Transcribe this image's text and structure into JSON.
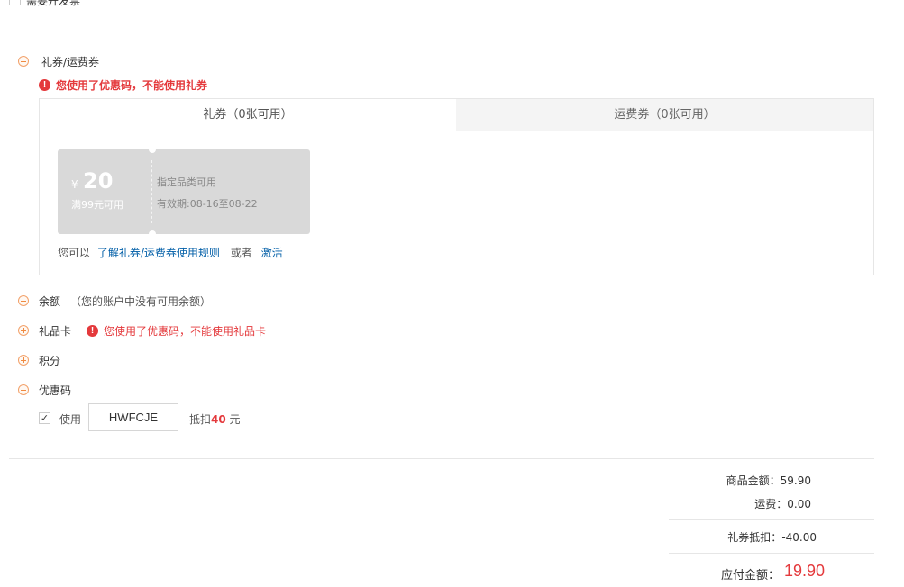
{
  "invoice": {
    "label": "需要开发票"
  },
  "gift_coupon": {
    "title": "礼券/运费券",
    "warning": "您使用了优惠码，不能使用礼券",
    "tabs": [
      {
        "label": "礼券（0张可用）",
        "active": true
      },
      {
        "label": "运费券（0张可用）",
        "active": false
      }
    ],
    "coupon": {
      "currency": "¥",
      "amount": "20",
      "condition": "满99元可用",
      "scope": "指定品类可用",
      "validity": "有效期:08-16至08-22"
    },
    "links": {
      "prefix": "您可以",
      "rules_link": "了解礼券/运费券使用规则",
      "or": "或者",
      "activate_link": "激活"
    }
  },
  "balance": {
    "title": "余额",
    "note": "（您的账户中没有可用余额）"
  },
  "gift_card": {
    "title": "礼品卡",
    "warning": "您使用了优惠码，不能使用礼品卡"
  },
  "points": {
    "title": "积分"
  },
  "promo_code": {
    "title": "优惠码",
    "checked": true,
    "use_label": "使用",
    "code": "HWFCJE",
    "deduct_prefix": "抵扣",
    "deduct_amount": "40",
    "deduct_unit": "元"
  },
  "summary": {
    "goods_label": "商品金额：",
    "goods_value": "59.90",
    "shipping_label": "运费：",
    "shipping_value": "0.00",
    "coupon_label": "礼券抵扣：",
    "coupon_value": "-40.00",
    "total_label": "应付金额：",
    "total_value": "19.90"
  },
  "colors": {
    "accent_red": "#e4393c",
    "link_blue": "#005ea7",
    "toggle_orange": "#f08a40"
  }
}
